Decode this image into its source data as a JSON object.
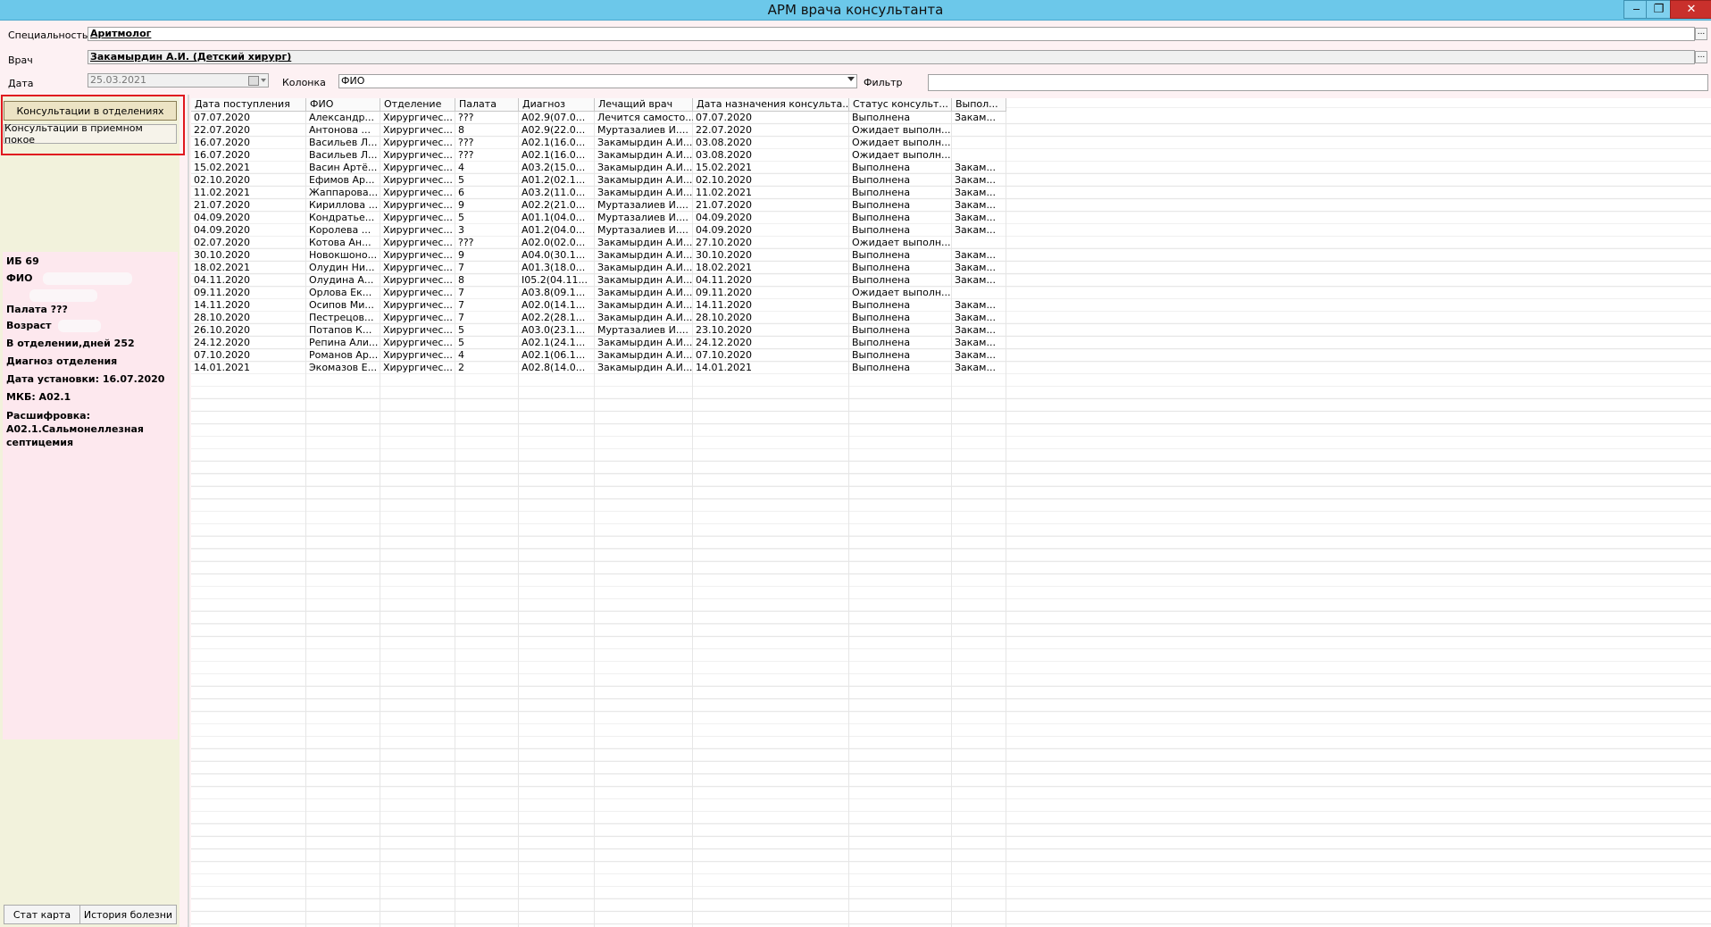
{
  "window": {
    "title": "АРМ врача консультанта",
    "minimize": "‒",
    "restore": "❐",
    "close": "✕"
  },
  "filters": {
    "specialty_label": "Специальность",
    "specialty_value": "Аритмолог",
    "doctor_label": "Врач",
    "doctor_value": "Закамырдин А.И. (Детский хирург)",
    "date_label": "Дата",
    "date_value": "25.03.2021",
    "column_label": "Колонка",
    "column_value": "ФИО",
    "filter_label": "Фильтр",
    "filter_value": "",
    "dots": "..."
  },
  "nav": {
    "departments": "Консультации в отделениях",
    "reception": "Консультации в приемном покое"
  },
  "patient": {
    "ib": "ИБ 69",
    "fio_label": "ФИО",
    "ward": "Палата ???",
    "age_label": "Возраст",
    "days": "В отделении,дней 252",
    "diag_label": "Диагноз отделения",
    "set_date": "Дата установки: 16.07.2020",
    "mkb": "МКБ: A02.1",
    "decode_label": "Расшифровка:",
    "decode_value": "A02.1.Сальмонеллезная септицемия"
  },
  "bottom": {
    "stat_card": "Стат карта",
    "history": "История болезни"
  },
  "table": {
    "headers": [
      "Дата поступления",
      "ФИО",
      "Отделение",
      "Палата",
      "Диагноз",
      "Лечащий врач",
      "Дата назначения консульта...",
      "Статус консульт...",
      "Выпол..."
    ],
    "rows": [
      [
        "07.07.2020",
        "Александр...",
        "Хирургичес...",
        "???",
        "A02.9(07.0...",
        "Лечится самосто...",
        "07.07.2020",
        "Выполнена",
        "Закам..."
      ],
      [
        "22.07.2020",
        "Антонова ...",
        "Хирургичес...",
        "8",
        "A02.9(22.0...",
        "Муртазалиев И....",
        "22.07.2020",
        "Ожидает выполн...",
        ""
      ],
      [
        "16.07.2020",
        "Васильев Л...",
        "Хирургичес...",
        "???",
        "A02.1(16.0...",
        "Закамырдин А.И...",
        "03.08.2020",
        "Ожидает выполн...",
        ""
      ],
      [
        "16.07.2020",
        "Васильев Л...",
        "Хирургичес...",
        "???",
        "A02.1(16.0...",
        "Закамырдин А.И...",
        "03.08.2020",
        "Ожидает выполн...",
        ""
      ],
      [
        "15.02.2021",
        "Васин Артё...",
        "Хирургичес...",
        "4",
        "A03.2(15.0...",
        "Закамырдин А.И...",
        "15.02.2021",
        "Выполнена",
        "Закам..."
      ],
      [
        "02.10.2020",
        "Ефимов Ар...",
        "Хирургичес...",
        "5",
        "A01.2(02.1...",
        "Закамырдин А.И...",
        "02.10.2020",
        "Выполнена",
        "Закам..."
      ],
      [
        "11.02.2021",
        "Жаппарова...",
        "Хирургичес...",
        "6",
        "A03.2(11.0...",
        "Закамырдин А.И...",
        "11.02.2021",
        "Выполнена",
        "Закам..."
      ],
      [
        "21.07.2020",
        "Кириллова ...",
        "Хирургичес...",
        "9",
        "A02.2(21.0...",
        "Муртазалиев И....",
        "21.07.2020",
        "Выполнена",
        "Закам..."
      ],
      [
        "04.09.2020",
        "Кондратье...",
        "Хирургичес...",
        "5",
        "A01.1(04.0...",
        "Муртазалиев И....",
        "04.09.2020",
        "Выполнена",
        "Закам..."
      ],
      [
        "04.09.2020",
        "Королева ...",
        "Хирургичес...",
        "3",
        "A01.2(04.0...",
        "Муртазалиев И....",
        "04.09.2020",
        "Выполнена",
        "Закам..."
      ],
      [
        "02.07.2020",
        "Котова Ан...",
        "Хирургичес...",
        "???",
        "A02.0(02.0...",
        "Закамырдин А.И...",
        "27.10.2020",
        "Ожидает выполн...",
        ""
      ],
      [
        "30.10.2020",
        "Новокшоно...",
        "Хирургичес...",
        "9",
        "A04.0(30.1...",
        "Закамырдин А.И...",
        "30.10.2020",
        "Выполнена",
        "Закам..."
      ],
      [
        "18.02.2021",
        "Олудин Ни...",
        "Хирургичес...",
        "7",
        "A01.3(18.0...",
        "Закамырдин А.И...",
        "18.02.2021",
        "Выполнена",
        "Закам..."
      ],
      [
        "04.11.2020",
        "Олудина А...",
        "Хирургичес...",
        "8",
        "I05.2(04.11...",
        "Закамырдин А.И...",
        "04.11.2020",
        "Выполнена",
        "Закам..."
      ],
      [
        "09.11.2020",
        "Орлова Ек...",
        "Хирургичес...",
        "7",
        "A03.8(09.1...",
        "Закамырдин А.И...",
        "09.11.2020",
        "Ожидает выполн...",
        ""
      ],
      [
        "14.11.2020",
        "Осипов Ми...",
        "Хирургичес...",
        "7",
        "A02.0(14.1...",
        "Закамырдин А.И...",
        "14.11.2020",
        "Выполнена",
        "Закам..."
      ],
      [
        "28.10.2020",
        "Пестрецов...",
        "Хирургичес...",
        "7",
        "A02.2(28.1...",
        "Закамырдин А.И...",
        "28.10.2020",
        "Выполнена",
        "Закам..."
      ],
      [
        "26.10.2020",
        "Потапов К...",
        "Хирургичес...",
        "5",
        "A03.0(23.1...",
        "Муртазалиев И....",
        "23.10.2020",
        "Выполнена",
        "Закам..."
      ],
      [
        "24.12.2020",
        "Репина Али...",
        "Хирургичес...",
        "5",
        "A02.1(24.1...",
        "Закамырдин А.И...",
        "24.12.2020",
        "Выполнена",
        "Закам..."
      ],
      [
        "07.10.2020",
        "Романов Ар...",
        "Хирургичес...",
        "4",
        "A02.1(06.1...",
        "Закамырдин А.И...",
        "07.10.2020",
        "Выполнена",
        "Закам..."
      ],
      [
        "14.01.2021",
        "Экомазов Е...",
        "Хирургичес...",
        "2",
        "A02.8(14.0...",
        "Закамырдин А.И...",
        "14.01.2021",
        "Выполнена",
        "Закам..."
      ]
    ]
  }
}
